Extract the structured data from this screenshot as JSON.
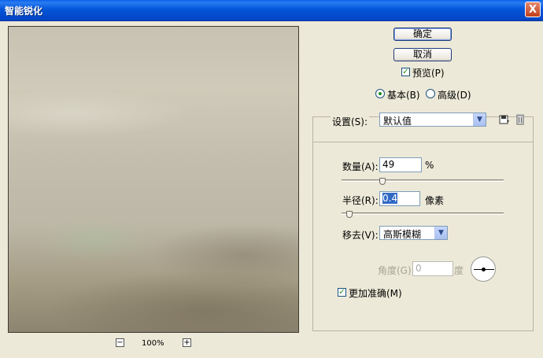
{
  "window": {
    "title": "智能锐化",
    "close": "X"
  },
  "preview": {
    "zoom_out": "−",
    "zoom_level": "100%",
    "zoom_in": "+"
  },
  "buttons": {
    "ok": "确定",
    "cancel": "取消"
  },
  "preview_checkbox": {
    "label": "预览(P)",
    "checked": true
  },
  "mode": {
    "basic": "基本(B)",
    "advanced": "高级(D)",
    "selected": "basic"
  },
  "settings": {
    "label": "设置(S):",
    "value": "默认值"
  },
  "amount": {
    "label": "数量(A):",
    "value": "49",
    "unit": "%",
    "slider_fraction": 0.25
  },
  "radius": {
    "label": "半径(R):",
    "value": "0.4",
    "unit": "像素",
    "slider_fraction": 0.05
  },
  "remove": {
    "label": "移去(V):",
    "value": "高斯模糊"
  },
  "angle": {
    "label": "角度(G):",
    "value": "0",
    "unit": "度"
  },
  "more_accurate": {
    "label": "更加准确(M)",
    "checked": true
  }
}
